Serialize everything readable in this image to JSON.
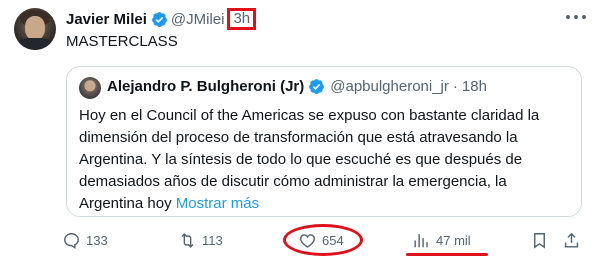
{
  "tweet": {
    "author_name": "Javier Milei",
    "handle": "@JMilei",
    "time": "3h",
    "text": "MASTERCLASS"
  },
  "quoted": {
    "author_name": "Alejandro P. Bulgheroni (Jr)",
    "handle": "@apbulgheroni_jr",
    "separator": "·",
    "time": "18h",
    "text": "Hoy en el Council of the Americas se expuso con bastante claridad la dimensión del proceso de transformación que está atravesando la Argentina. Y la síntesis de todo lo que escuché es que después de demasiados años de discutir cómo administrar la emergencia, la Argentina hoy",
    "show_more": "Mostrar más"
  },
  "actions": {
    "replies": "133",
    "retweets": "113",
    "likes": "654",
    "views": "47 mil"
  },
  "colors": {
    "verified": "#1d9bf0",
    "annotation": "#e0101a",
    "link": "#1d9bf0",
    "muted": "#536471"
  }
}
